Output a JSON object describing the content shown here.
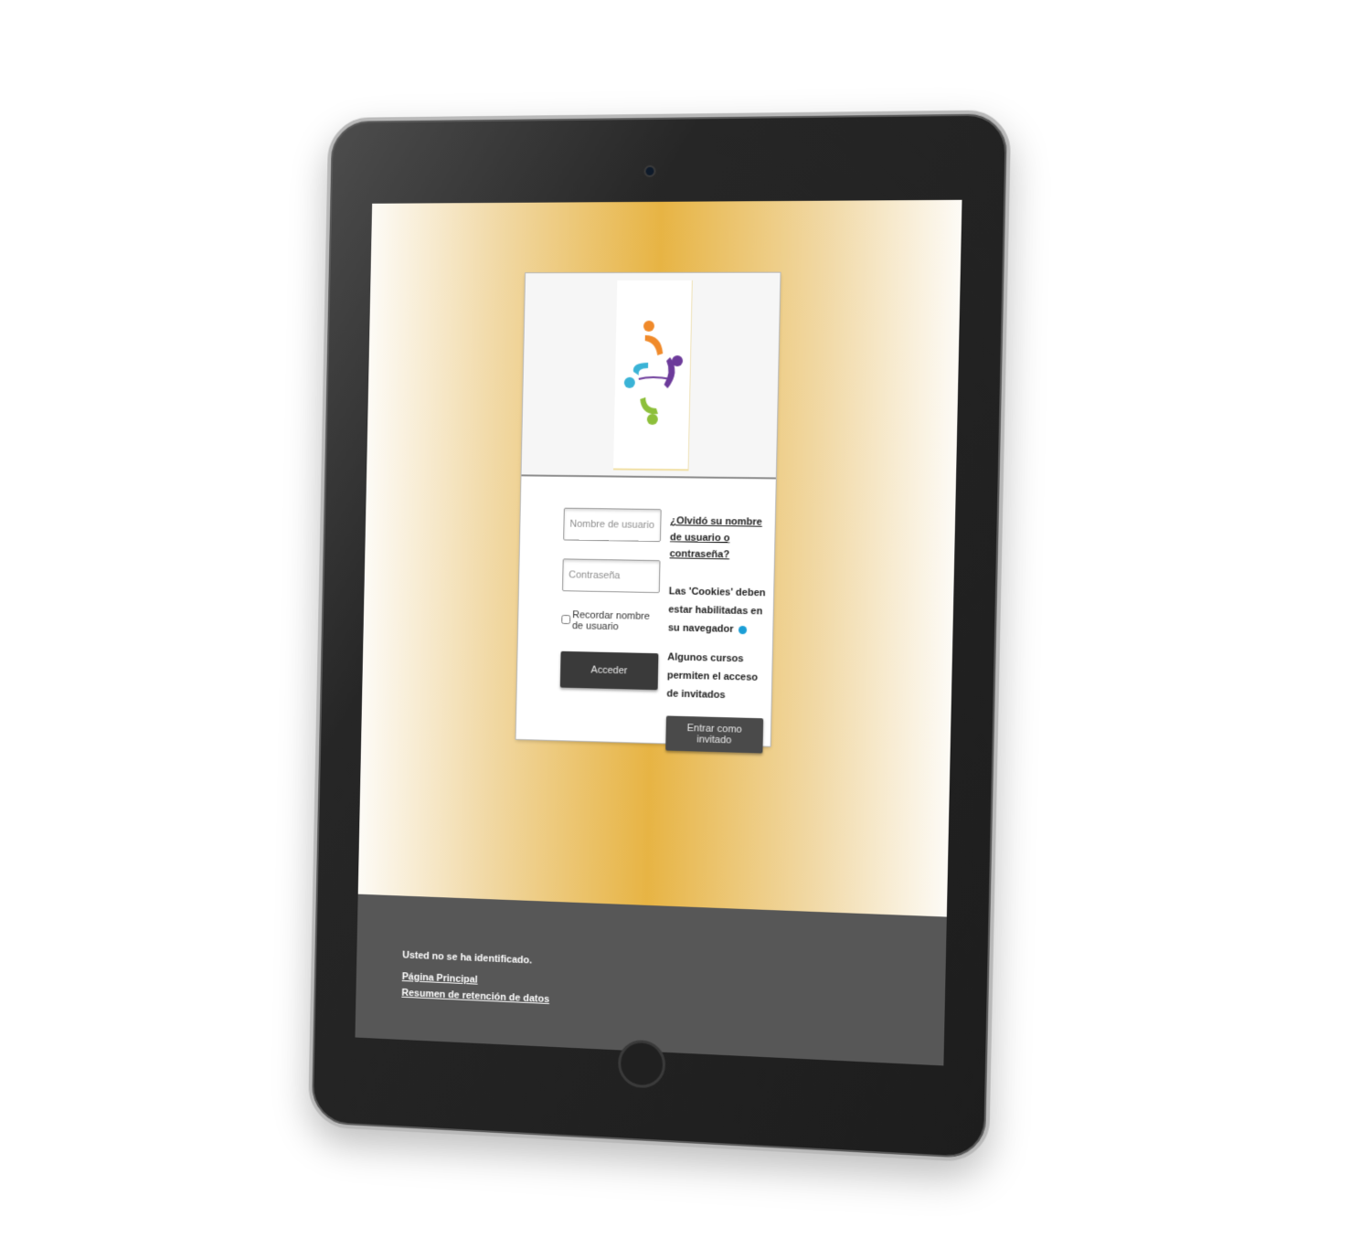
{
  "login": {
    "username_placeholder": "Nombre de usuario",
    "password_placeholder": "Contraseña",
    "remember_label": "Recordar nombre de usuario",
    "login_button": "Acceder",
    "forgot_link": "¿Olvidó su nombre de usuario o contraseña?",
    "cookies_notice": "Las 'Cookies' deben estar habilitadas en su navegador",
    "guest_notice": "Algunos cursos permiten el acceso de invitados",
    "guest_button": "Entrar como invitado"
  },
  "footer": {
    "status": "Usted no se ha identificado.",
    "home_link": "Página Principal",
    "retention_link": "Resumen de retención de datos"
  },
  "colors": {
    "background_gold": "#e7b444",
    "footer_gray": "#575757",
    "button_dark": "#3a3a3a",
    "info_blue": "#1a9ed6"
  }
}
